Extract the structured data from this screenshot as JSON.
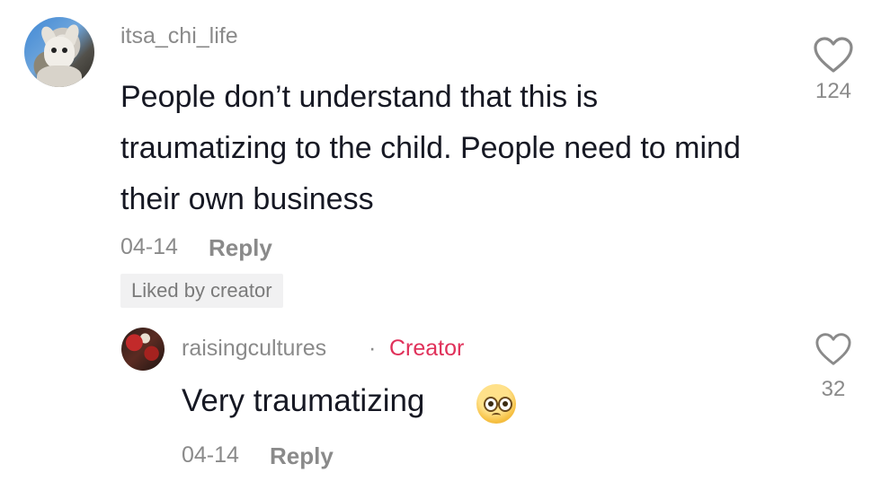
{
  "comment": {
    "username": "itsa_chi_life",
    "text": "People don’t understand that this is traumatizing to the child. People need to mind their own business",
    "date": "04-14",
    "reply_label": "Reply",
    "liked_badge": "Liked by creator",
    "like_count": "124",
    "avatar_icon": "avatar-chihuahua"
  },
  "reply": {
    "username": "raisingcultures",
    "separator": "·",
    "creator_label": "Creator",
    "text": "Very traumatizing",
    "emoji": "pleading-face-emoji",
    "date": "04-14",
    "reply_label": "Reply",
    "like_count": "32"
  },
  "colors": {
    "text_primary": "#161823",
    "text_secondary": "#8a8a8a",
    "creator_accent": "#e0315a",
    "badge_bg": "#f1f1f2"
  },
  "icons": {
    "like": "heart-outline-icon"
  }
}
